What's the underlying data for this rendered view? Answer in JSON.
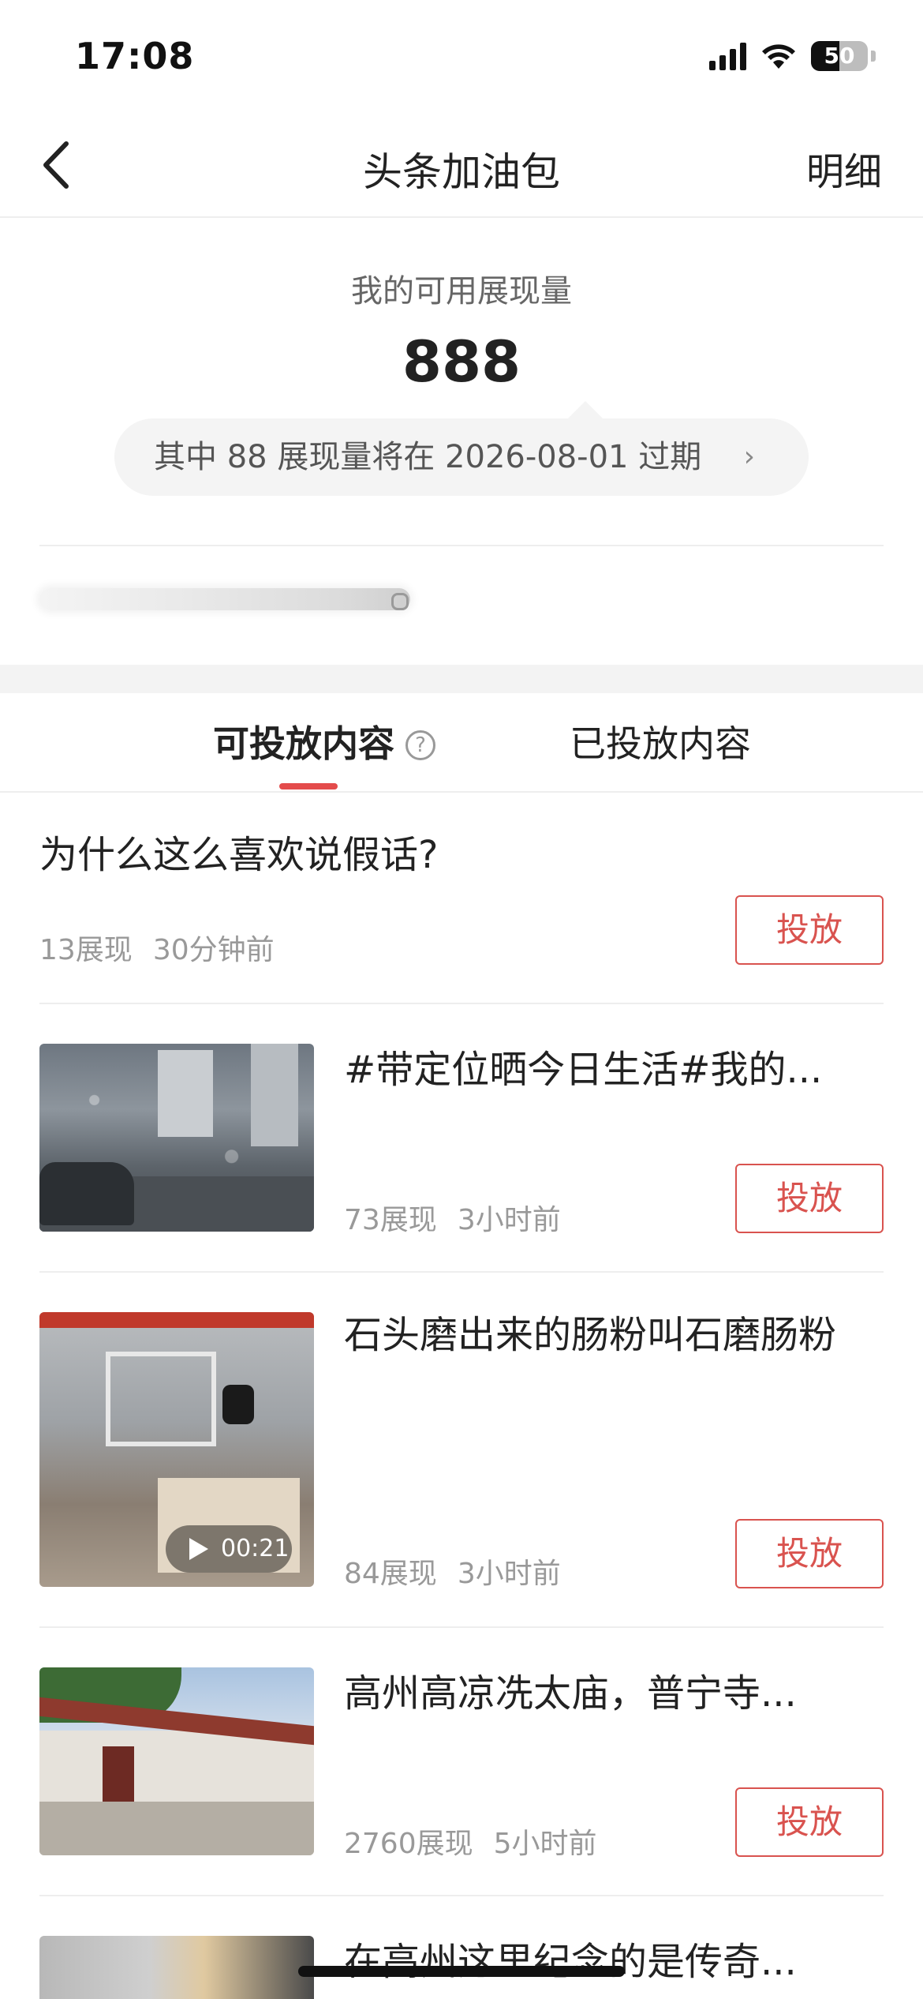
{
  "status_bar": {
    "time": "17:08",
    "battery": "50",
    "battery_level": 0.5
  },
  "nav": {
    "back_icon": "chevron-left-icon",
    "title": "头条加油包",
    "detail": "明细"
  },
  "summary": {
    "label": "我的可用展现量",
    "value": "888",
    "expire_text": "其中 88 展现量将在 2026-08-01 过期",
    "expire_chevron": "›"
  },
  "tabs": {
    "available": "可投放内容",
    "help": "?",
    "delivered": "已投放内容"
  },
  "items": [
    {
      "title": "为什么这么喜欢说假话?",
      "impressions": "13展现",
      "time": "30分钟前",
      "button": "投放"
    },
    {
      "title": "#带定位晒今日生活#我的...",
      "impressions": "73展现",
      "time": "3小时前",
      "button": "投放"
    },
    {
      "title": "石头磨出来的肠粉叫石磨肠粉",
      "impressions": "84展现",
      "time": "3小时前",
      "button": "投放",
      "video_duration": "00:21"
    },
    {
      "title": "高州高凉冼太庙，普宁寺...",
      "impressions": "2760展现",
      "time": "5小时前",
      "button": "投放"
    },
    {
      "title": "在高州这里纪念的是传奇..."
    }
  ],
  "colors": {
    "accent": "#e44b4b",
    "button_border": "#d9534f"
  }
}
